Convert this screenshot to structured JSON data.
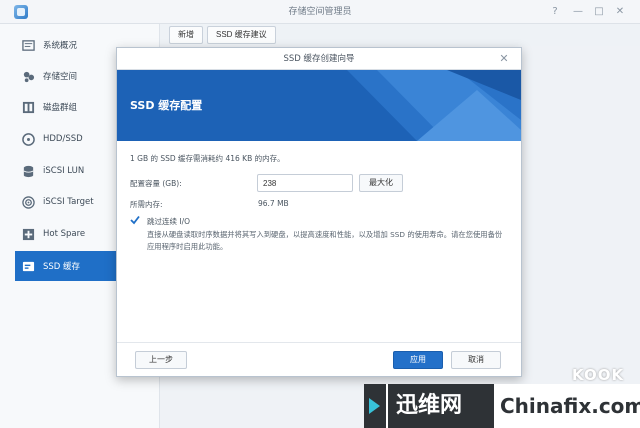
{
  "window": {
    "title": "存储空间管理员",
    "help": "?",
    "minimize": "—",
    "maximize": "□",
    "close": "✕"
  },
  "sidebar": {
    "items": [
      {
        "label": "系统概况",
        "icon": "overview-icon"
      },
      {
        "label": "存储空间",
        "icon": "storage-icon"
      },
      {
        "label": "磁盘群组",
        "icon": "disk-group-icon"
      },
      {
        "label": "HDD/SSD",
        "icon": "drive-icon"
      },
      {
        "label": "iSCSI LUN",
        "icon": "database-icon"
      },
      {
        "label": "iSCSI Target",
        "icon": "target-icon"
      },
      {
        "label": "Hot Spare",
        "icon": "plus-icon"
      },
      {
        "label": "SSD 缓存",
        "icon": "ssd-cache-icon",
        "active": true
      }
    ]
  },
  "toolbar": {
    "new_label": "新增",
    "advice_label": "SSD 缓存建议"
  },
  "dialog": {
    "title": "SSD 缓存创建向导",
    "close": "✕",
    "header_title": "SSD 缓存配置",
    "memory_note": "1 GB 的 SSD 缓存需消耗约 416 KB 的内存。",
    "size_label": "配置容量 (GB):",
    "size_value": "238",
    "max_button": "最大化",
    "memory_label": "所需内存:",
    "memory_value": "96.7 MB",
    "skip_label": "跳过连续 I/O",
    "skip_checked": true,
    "skip_desc": "直接从硬盘读取时序数据并将其写入到硬盘，以提高速度和性能，以及增加 SSD 的使用寿命。请在您使用备份应用程序时启用此功能。",
    "prev_button": "上一步",
    "apply_button": "应用",
    "cancel_button": "取消"
  },
  "watermark": {
    "cn": "迅维网",
    "en": "Chinafix.com",
    "kook": "KOOK"
  },
  "colors": {
    "accent": "#1f6fc7",
    "header": "#1d62b6",
    "sidebar_bg": "#f7f9fb"
  }
}
